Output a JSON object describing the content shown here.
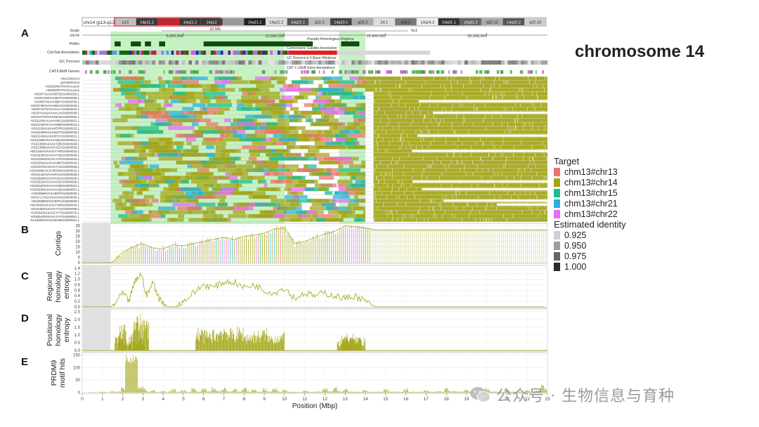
{
  "figure": {
    "title": "chromosome 14",
    "panels": [
      {
        "letter": "A"
      },
      {
        "letter": "B"
      },
      {
        "letter": "C"
      },
      {
        "letter": "D"
      },
      {
        "letter": "E"
      }
    ],
    "x_axis_label": "Position (Mbp)"
  },
  "browser": {
    "position_label": "chr14 (p13-q12)",
    "bands": [
      {
        "label": "p13",
        "color": "#bfbfbf"
      },
      {
        "label": "14p11.2",
        "color": "#3a3a3a"
      },
      {
        "label": "",
        "color": "#c1272d"
      },
      {
        "label": "14q11.2",
        "color": "#3a3a3a"
      },
      {
        "label": "14q12",
        "color": "#3a3a3a"
      },
      {
        "label": "",
        "color": "#999999"
      },
      {
        "label": "14q21.1",
        "color": "#222222"
      },
      {
        "label": "14q21.2",
        "color": "#dddddd"
      },
      {
        "label": "14q22.1",
        "color": "#555555"
      },
      {
        "label": "q22.3",
        "color": "#bbbbbb"
      },
      {
        "label": "14q23.1",
        "color": "#444444"
      },
      {
        "label": "q23.3",
        "color": "#aaaaaa"
      },
      {
        "label": "24.1",
        "color": "#dddddd"
      },
      {
        "label": "q24.2",
        "color": "#777777"
      },
      {
        "label": "14q24.3",
        "color": "#eeeeee"
      },
      {
        "label": "14q31.1",
        "color": "#333333"
      },
      {
        "label": "14q31.3",
        "color": "#666666"
      },
      {
        "label": "q32.12",
        "color": "#aaaaaa"
      },
      {
        "label": "14q32.2",
        "color": "#555555"
      },
      {
        "label": "q32.33",
        "color": "#cccccc"
      }
    ],
    "scale_label": "Scale",
    "chr_label": "chr14",
    "scale_bar_text": "10 Mb",
    "assembly_label": "hs1",
    "ruler_ticks": [
      "5,000,000",
      "10,000,000",
      "15,000,000",
      "20,000,000"
    ],
    "tracks": {
      "phr_label": "PHRs",
      "phr_annotation": "Pseudo-Homologous Regions",
      "censat_label": "CenSat Annotation",
      "censat_annotation": "Centromeric Satellite Annotation",
      "gc_label": "GC Percent",
      "gc_annotation": "GC Percent in 5-Base Windows",
      "cat_label": "CAT/Liftoff Genes",
      "cat_annotation": "CAT + Liftoff Gene Annotations"
    },
    "sample_labels": [
      "chm13#chr14",
      "grch38#chr14",
      "HG002#MAT#chr14.prox",
      "HG002#PAT#chr14.prox",
      "HG00741#JAHEPQ010000025.1",
      "HG00735#JAHBCF010000035.1",
      "HG00673#JAHBBY010000032.1",
      "HG00735#1#JAHBCH010000039.1",
      "HG00741#1#JAHALY010000010.1",
      "HG00741#2#JAHALX010000038.1",
      "HG01071#2#JAHBCE010000052.1",
      "HG01106#1#JAHAMC010000001.1",
      "HG01106#2#JAHAMB010000013.1",
      "HG01109#1#JAHEPR010000025.1",
      "HG01109#2#JAHEOT010000035.1",
      "HG01243#1#JAHEOY010000012.1",
      "HG01258#2#JAHAMU010000021.1",
      "HG01358#1#JAGYZB010000040.1",
      "HG01358#2#JAGYZA010000059.1",
      "HG01361#1#JAGYYW010000032.1",
      "HG01928#1#JAGYVQ010000046.1",
      "HG01928#2#JAGYVP010000023.1",
      "HG01952#1#JAHAME010000044.1",
      "HG01978#1#JAGYVS010000055.1",
      "HG02080#1#JAHEOW010000022.1",
      "HG02145#1#JAHKSG010000039.1",
      "HG02559#1#JAHAOU010000040.1",
      "HG02622#1#JAHAOO010000005.1",
      "HG02630#2#JAHAOM010000024.1",
      "HG02630#1#JAHAOQ010000067.1",
      "HG03098#1#JAHEPF010000030.1",
      "HG02717#1#JAHAOS010000030.1",
      "HG03098#2#JAHEPL010000008.1",
      "HG03453#1#JAGYVW010000042.1",
      "HG03492#1#JAGYYV010000008.1",
      "HG03516#1#JAGYYT010000076.1",
      "HG03540#2#JAGYVY010000061.1",
      "NA18906#2#JAHEOM010000010.1"
    ]
  },
  "axes": {
    "b_label": "Contigs",
    "c_label_lines": [
      "Regional",
      "homology",
      "entropy"
    ],
    "d_label_lines": [
      "Positional",
      "homology",
      "entropy"
    ],
    "e_label_lines": [
      "PRDM9",
      "motif hits"
    ],
    "b_ticks": [
      "0",
      "5",
      "10",
      "15",
      "20",
      "25",
      "30",
      "35"
    ],
    "c_ticks": [
      "0.0",
      "0.2",
      "0.4",
      "0.6",
      "0.8",
      "1.0",
      "1.2",
      "1.4"
    ],
    "d_ticks": [
      "0.0",
      "0.5",
      "1.0",
      "1.5",
      "2.0",
      "2.5"
    ],
    "e_ticks": [
      "0",
      "50",
      "100",
      "150"
    ],
    "x_ticks": [
      "0",
      "1",
      "2",
      "3",
      "4",
      "5",
      "6",
      "7",
      "8",
      "9",
      "10",
      "11",
      "12",
      "13",
      "14",
      "15",
      "16",
      "17",
      "18",
      "19",
      "20",
      "21",
      "22",
      "23"
    ]
  },
  "legend": {
    "target_title": "Target",
    "targets": [
      {
        "label": "chm13#chr13",
        "color": "#f0706b"
      },
      {
        "label": "chm13#chr14",
        "color": "#a3a514"
      },
      {
        "label": "chm13#chr15",
        "color": "#1bbf8f"
      },
      {
        "label": "chm13#chr21",
        "color": "#23b3e0"
      },
      {
        "label": "chm13#chr22",
        "color": "#e76bf3"
      }
    ],
    "identity_title": "Estimated identity",
    "identities": [
      {
        "label": "0.925",
        "color": "#cfcfcf"
      },
      {
        "label": "0.950",
        "color": "#9e9e9e"
      },
      {
        "label": "0.975",
        "color": "#666666"
      },
      {
        "label": "1.000",
        "color": "#2a2a2a"
      }
    ]
  },
  "highlight": {
    "color": "#7fe07a",
    "regions_mbp": [
      [
        1.4,
        10.0
      ],
      [
        12.7,
        14.0
      ]
    ]
  },
  "watermark": {
    "text": "公众号 · 生物信息与育种"
  },
  "chart_data": [
    {
      "type": "heatmap",
      "panel": "A",
      "title": "",
      "xlabel": "Position (Mbp)",
      "ylabel": "",
      "xlim": [
        0,
        23
      ],
      "series_colors": {
        "chm13#chr14": "#a3a514",
        "chm13#chr13": "#f0706b",
        "chm13#chr15": "#1bbf8f",
        "chm13#chr21": "#23b3e0",
        "chm13#chr22": "#e76bf3"
      },
      "highlighted_regions_mbp": [
        [
          1.4,
          10.0
        ],
        [
          12.7,
          14.0
        ]
      ]
    },
    {
      "type": "area",
      "panel": "B",
      "ylabel": "Contigs",
      "xlabel": "Position (Mbp)",
      "xlim": [
        0,
        23
      ],
      "ylim": [
        0,
        35
      ],
      "x": [
        0.0,
        1.4,
        1.6,
        2.0,
        2.5,
        3.0,
        3.5,
        4.0,
        4.5,
        5.0,
        5.5,
        6.0,
        6.5,
        7.0,
        7.5,
        8.0,
        8.5,
        9.0,
        9.5,
        10.0,
        10.5,
        11.0,
        11.5,
        12.0,
        12.5,
        12.8,
        13.0,
        13.5,
        14.0,
        14.5,
        15.0,
        16.0,
        17.0,
        18.0,
        19.0,
        20.0,
        21.0,
        22.0,
        23.0
      ],
      "values": [
        0,
        0,
        2,
        10,
        15,
        18,
        14,
        13,
        17,
        16,
        18,
        20,
        22,
        24,
        22,
        25,
        26,
        28,
        32,
        33,
        18,
        20,
        24,
        27,
        30,
        33,
        35,
        34,
        33,
        31,
        31,
        31,
        31,
        31,
        31,
        31,
        31,
        31,
        31
      ]
    },
    {
      "type": "line",
      "panel": "C",
      "ylabel": "Regional homology entropy",
      "xlabel": "Position (Mbp)",
      "xlim": [
        0,
        23
      ],
      "ylim": [
        0,
        1.5
      ],
      "x": [
        0.0,
        1.4,
        1.6,
        2.0,
        2.3,
        2.6,
        2.9,
        3.2,
        3.5,
        3.8,
        4.2,
        4.6,
        5.0,
        5.5,
        6.0,
        6.5,
        7.0,
        7.5,
        8.0,
        8.5,
        9.0,
        9.5,
        10.0,
        10.5,
        11.0,
        11.5,
        12.0,
        12.5,
        13.0,
        13.5,
        14.0,
        14.5,
        16.0,
        18.0,
        20.0,
        22.0,
        23.0
      ],
      "values": [
        0,
        0,
        0.1,
        0.5,
        0.2,
        0.9,
        1.2,
        0.4,
        0.9,
        0.3,
        0.0,
        0.0,
        0.2,
        0.5,
        0.8,
        0.7,
        0.9,
        0.9,
        0.7,
        0.8,
        0.6,
        0.5,
        0.7,
        0.3,
        0.5,
        0.4,
        0.5,
        0.4,
        0.3,
        0.4,
        0.2,
        0.0,
        0.0,
        0.0,
        0.0,
        0.0,
        0.0
      ]
    },
    {
      "type": "bar",
      "panel": "D",
      "ylabel": "Positional homology entropy",
      "xlabel": "Position (Mbp)",
      "xlim": [
        0,
        23
      ],
      "ylim": [
        0,
        2.5
      ],
      "x": [
        1.8,
        2.0,
        2.2,
        2.5,
        2.7,
        2.9,
        3.1,
        5.8,
        6.2,
        6.6,
        7.0,
        7.4,
        7.8,
        8.2,
        8.6,
        9.0,
        9.4,
        9.8,
        12.8,
        13.0,
        13.2,
        13.4,
        13.6,
        13.8
      ],
      "values": [
        0.8,
        1.5,
        0.4,
        1.0,
        2.0,
        0.6,
        1.8,
        1.3,
        1.1,
        1.2,
        1.5,
        1.2,
        1.3,
        1.0,
        1.1,
        1.2,
        0.9,
        1.0,
        0.6,
        0.8,
        0.9,
        0.8,
        0.7,
        0.7
      ]
    },
    {
      "type": "bar",
      "panel": "E",
      "ylabel": "PRDM9 motif hits",
      "xlabel": "Position (Mbp)",
      "xlim": [
        0,
        23
      ],
      "ylim": [
        0,
        175
      ],
      "x": [
        0.5,
        1.0,
        1.5,
        2.0,
        2.2,
        2.4,
        2.6,
        2.8,
        3.0,
        3.5,
        4.0,
        4.5,
        5.0,
        5.5,
        6.0,
        6.5,
        7.0,
        7.5,
        8.0,
        8.5,
        9.0,
        9.5,
        10.0,
        11.0,
        12.0,
        12.5,
        13.0,
        14.0,
        15.0,
        16.0,
        17.0,
        18.0,
        19.0,
        20.0,
        21.0,
        22.0,
        22.8
      ],
      "values": [
        2,
        4,
        6,
        20,
        160,
        170,
        165,
        30,
        25,
        10,
        8,
        15,
        12,
        20,
        18,
        25,
        20,
        15,
        22,
        12,
        18,
        20,
        15,
        10,
        20,
        25,
        15,
        12,
        14,
        18,
        12,
        20,
        16,
        18,
        15,
        12,
        30
      ]
    }
  ]
}
